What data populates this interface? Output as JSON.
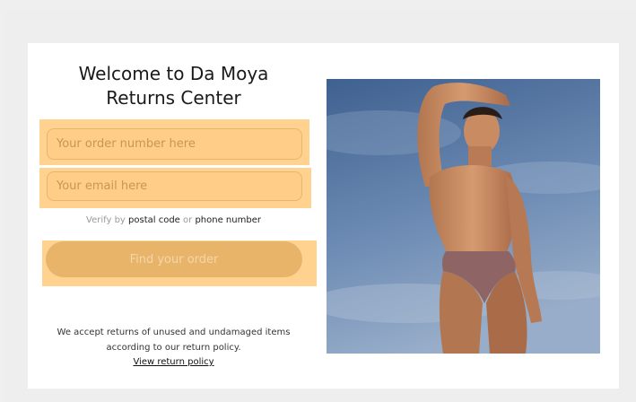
{
  "header": {
    "title_line1": "Welcome to Da Moya",
    "title_line2": "Returns Center"
  },
  "form": {
    "order_placeholder": "Your order number here",
    "email_placeholder": "Your email here",
    "verify_prefix": "Verify by",
    "verify_postal": "postal code",
    "verify_or": "or",
    "verify_phone": "phone number",
    "find_button": "Find your order"
  },
  "footer": {
    "note_line1": "We accept returns of unused and undamaged items",
    "note_line2": "according to our return policy.",
    "view_policy": "View return policy"
  },
  "colors": {
    "highlight": "#ffd28f",
    "button": "#e8b46a",
    "sky_top": "#4f6e98",
    "sky_bottom": "#8aa3c4"
  }
}
